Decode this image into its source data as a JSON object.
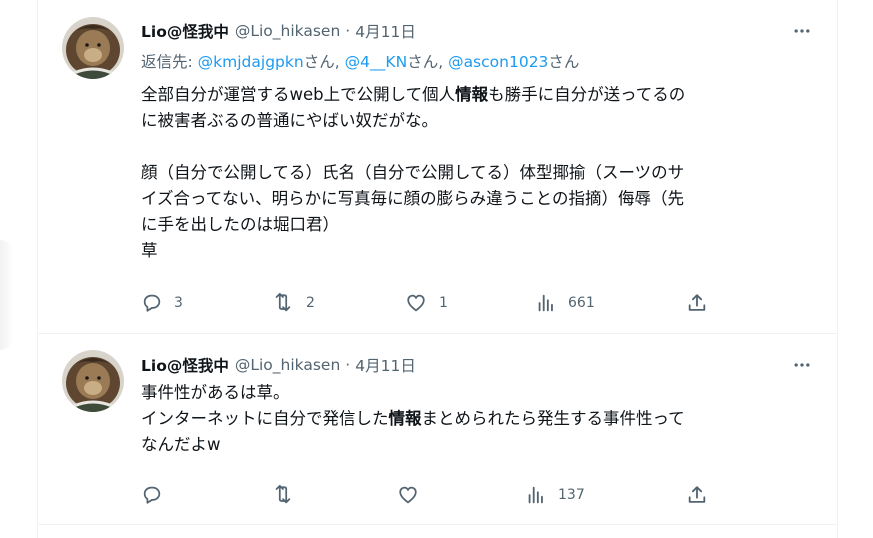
{
  "tweets": [
    {
      "author": {
        "name": "Lio@怪我中",
        "handle": "@Lio_hikasen"
      },
      "separator": "·",
      "date": "4月11日",
      "reply_to": {
        "label": "返信先:",
        "mentions": [
          {
            "handle": "@kmjdajgpkn",
            "suffix": "さん,"
          },
          {
            "handle": "@4__KN",
            "suffix": "さん,"
          },
          {
            "handle": "@ascon1023",
            "suffix": "さん"
          }
        ]
      },
      "text": {
        "l1_pre": "全部自分が運営するweb上で公開して個人",
        "l1_bold": "情報",
        "l1_post": "も勝手に自分が送ってるの",
        "l2": "に被害者ぶるの普通にやばい奴だがな。",
        "l3": "",
        "l4": "顔（自分で公開してる）氏名（自分で公開してる）体型揶揄（スーツのサ",
        "l5": "イズ合ってない、明らかに写真毎に顔の膨らみ違うことの指摘）侮辱（先",
        "l6": "に手を出したのは堀口君）",
        "l7": "草"
      },
      "actions": {
        "reply_count": "3",
        "retweet_count": "2",
        "like_count": "1",
        "views_count": "661"
      }
    },
    {
      "author": {
        "name": "Lio@怪我中",
        "handle": "@Lio_hikasen"
      },
      "separator": "·",
      "date": "4月11日",
      "text": {
        "l1": "事件性があるは草。",
        "l2_pre": "インターネットに自分で発信した",
        "l2_bold": "情報",
        "l2_post": "まとめられたら発生する事件性って",
        "l3": "なんだよw"
      },
      "actions": {
        "views_count": "137"
      }
    }
  ],
  "icons": {
    "more": "more-dots-icon",
    "reply": "reply-bubble-icon",
    "retweet": "retweet-icon",
    "like": "heart-icon",
    "views": "views-chart-icon",
    "share": "share-upload-icon"
  },
  "colors": {
    "text": "#0f1419",
    "secondary": "#536471",
    "mention": "#1d9bf0",
    "border": "#eff3f4"
  }
}
